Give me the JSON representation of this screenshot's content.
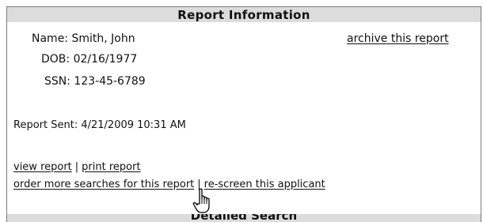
{
  "header": {
    "title": "Report Information"
  },
  "applicant": {
    "name_label": "Name:",
    "name_value": "Smith, John",
    "dob_label": "DOB:",
    "dob_value": "02/16/1977",
    "ssn_label": "SSN:",
    "ssn_value": "123-45-6789"
  },
  "actions": {
    "archive_label": "archive this report",
    "view_label": "view report",
    "print_label": "print report",
    "order_label": "order more searches for this report",
    "rescreen_label": "re-screen this applicant",
    "separator": "|"
  },
  "report_sent": {
    "label": "Report Sent:",
    "value": "4/21/2009 10:31 AM"
  },
  "next_section": {
    "title": "Detailed Search"
  },
  "icons": {
    "cursor": "hand-pointer-icon"
  },
  "colors": {
    "header_bg": "#dcdcdc",
    "border": "#7a7a7a",
    "text": "#111111"
  }
}
